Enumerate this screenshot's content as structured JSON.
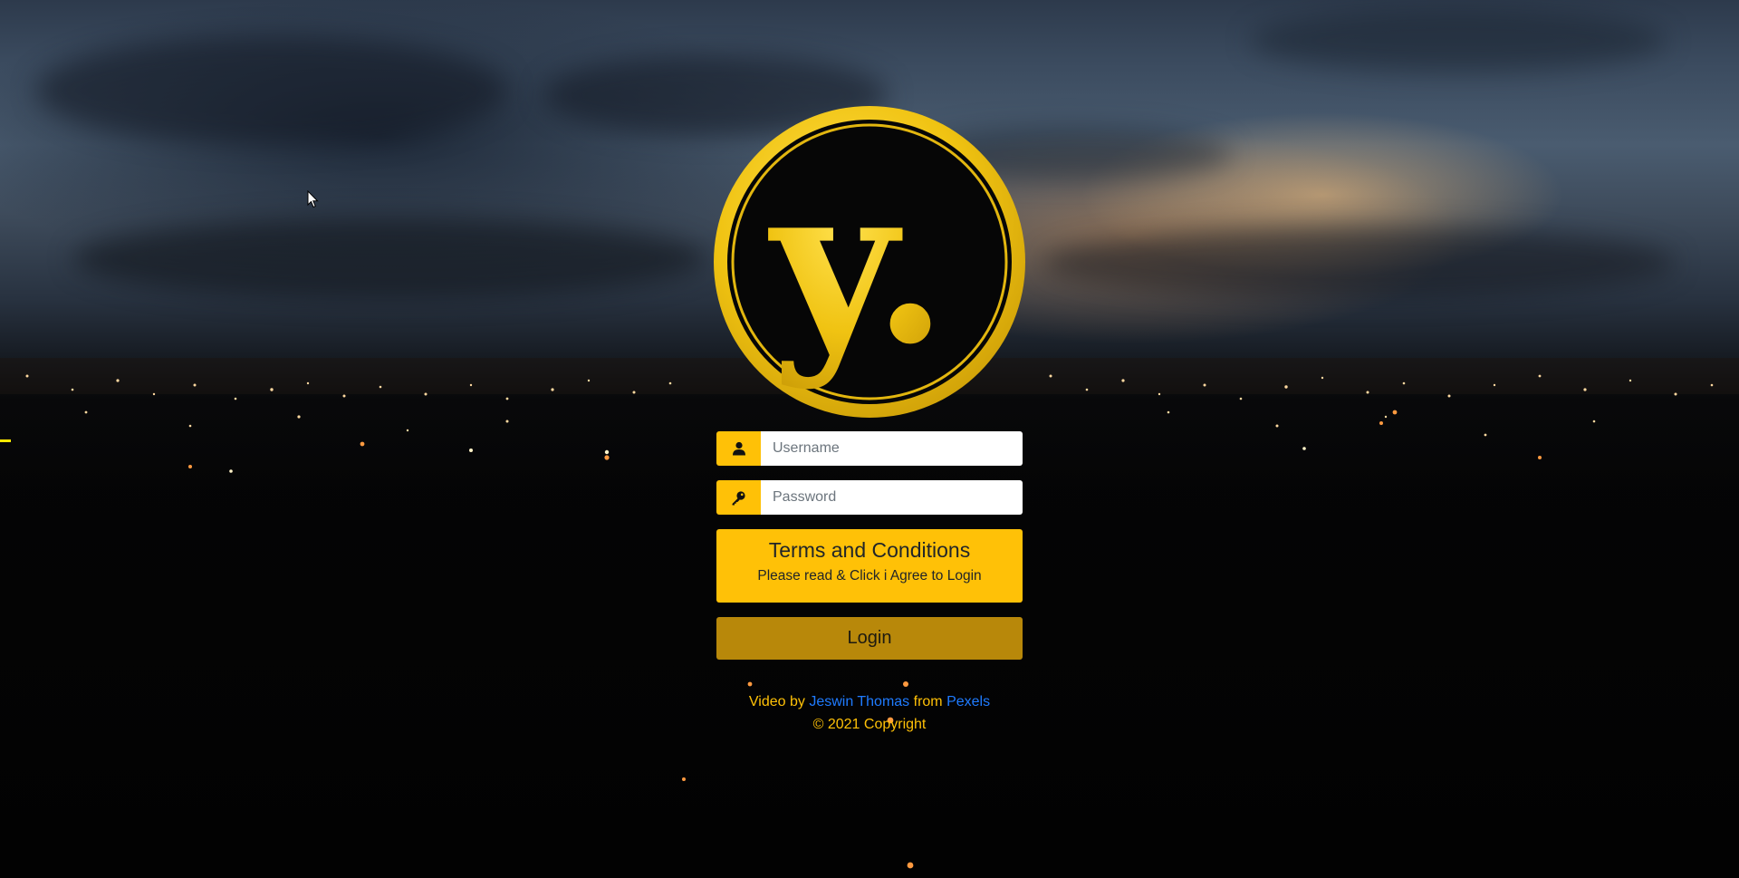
{
  "brand": {
    "logo_letter": "y.",
    "colors": {
      "gold": "#ffc107",
      "login_button": "#b8880a",
      "link": "#1f7bff",
      "logo_gold": "#e7b810"
    }
  },
  "login": {
    "username_placeholder": "Username",
    "password_placeholder": "Password",
    "username_icon": "user-icon",
    "password_icon": "key-icon",
    "terms_title": "Terms and Conditions",
    "terms_subtitle": "Please read & Click i Agree to Login",
    "login_label": "Login"
  },
  "credits": {
    "video_by": "Video by",
    "author": "Jeswin Thomas",
    "from": "from",
    "source": "Pexels",
    "copyright": "© 2021 Copyright"
  }
}
